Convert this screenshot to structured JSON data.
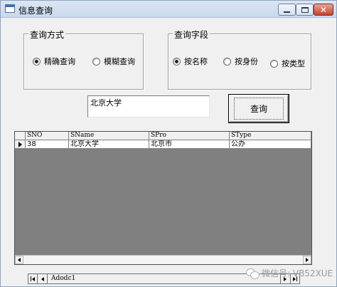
{
  "window": {
    "title": "信息查询"
  },
  "query_mode": {
    "legend": "查询方式",
    "options": [
      {
        "label": "精确查询",
        "selected": true
      },
      {
        "label": "模糊查询",
        "selected": false
      }
    ]
  },
  "query_field": {
    "legend": "查询字段",
    "options": [
      {
        "label": "按名称",
        "selected": true
      },
      {
        "label": "按身份",
        "selected": false
      },
      {
        "label": "按类型",
        "selected": false
      }
    ]
  },
  "search": {
    "value": "北京大学",
    "button_label": "查询"
  },
  "grid": {
    "columns": [
      "SNO",
      "SName",
      "SPro",
      "SType"
    ],
    "rows": [
      [
        "38",
        "北京大学",
        "北京市",
        "公办"
      ]
    ]
  },
  "ado": {
    "caption": "Adodc1"
  },
  "watermark": {
    "text": "微信号: VB52XUE"
  }
}
